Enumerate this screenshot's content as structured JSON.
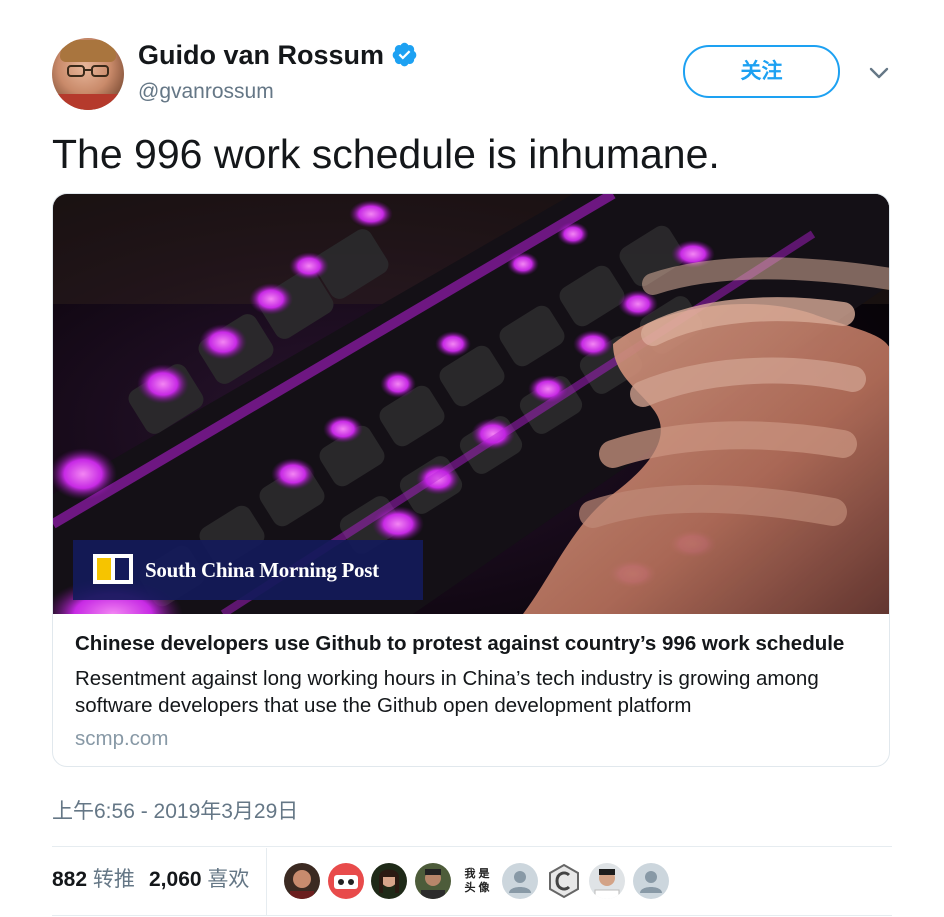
{
  "user": {
    "name": "Guido van Rossum",
    "handle": "@gvanrossum",
    "verified": true
  },
  "follow_button": {
    "label": "关注"
  },
  "tweet": {
    "text": "The 996 work schedule is inhumane."
  },
  "card": {
    "image_logo_text": "South China Morning Post",
    "title": "Chinese developers use Github to protest against country’s 996 work schedule",
    "description": "Resentment against long working hours in China’s tech industry is growing among software developers that use the Github open development platform",
    "domain": "scmp.com"
  },
  "timestamp": "上午6:56 - 2019年3月29日",
  "stats": {
    "retweets_count": "882",
    "retweets_label": "转推",
    "likes_count": "2,060",
    "likes_label": "喜欢"
  },
  "liker_text_avatar": {
    "line1": "我 是",
    "line2": "头 像"
  },
  "colors": {
    "accent": "#1da1f2",
    "text": "#14171a",
    "muted": "#657786",
    "key_glow": "#e040fb"
  },
  "icons": [
    "verified-badge-icon",
    "chevron-down-icon"
  ]
}
